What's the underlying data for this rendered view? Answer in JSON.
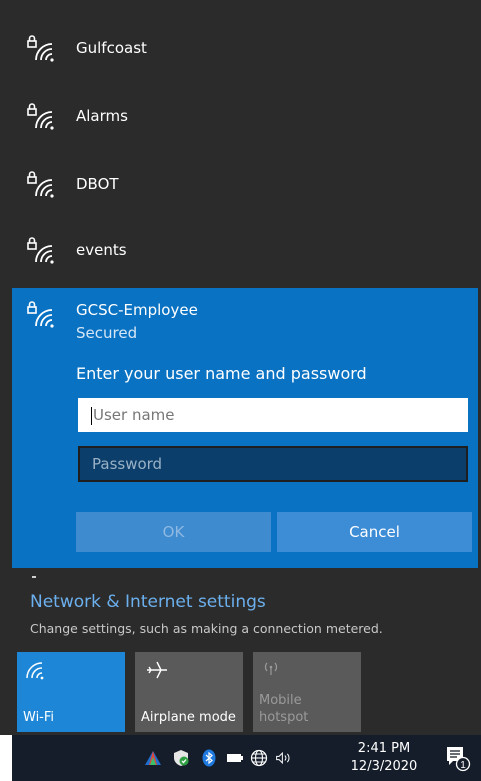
{
  "networks": [
    {
      "name": "Gulfcoast",
      "icon": "secured-wifi-icon"
    },
    {
      "name": "Alarms",
      "icon": "secured-wifi-icon"
    },
    {
      "name": "DBOT",
      "icon": "secured-wifi-icon"
    },
    {
      "name": "events",
      "icon": "secured-wifi-icon"
    }
  ],
  "selected_network": {
    "name": "GCSC-Employee",
    "status": "Secured",
    "prompt": "Enter your user name and password",
    "username_placeholder": "User name",
    "password_placeholder": "Password",
    "ok_label": "OK",
    "cancel_label": "Cancel"
  },
  "settings": {
    "title": "Network & Internet settings",
    "subtitle": "Change settings, such as making a connection metered."
  },
  "quick_actions": [
    {
      "label": "Wi-Fi",
      "icon": "wifi-icon",
      "active": true
    },
    {
      "label": "Airplane mode",
      "icon": "airplane-icon",
      "active": false
    },
    {
      "label": "Mobile hotspot",
      "icon": "hotspot-icon",
      "active": false,
      "disabled": true
    }
  ],
  "taskbar": {
    "time": "2:41 PM",
    "date": "12/3/2020",
    "notification_count": "1",
    "tray_icons": [
      "app-triangle-icon",
      "defender-icon",
      "bluetooth-icon",
      "battery-icon",
      "network-globe-icon",
      "volume-icon"
    ]
  },
  "colors": {
    "flyout_bg": "#2b2b2b",
    "accent": "#0a72c2",
    "link": "#6cb0ee",
    "taskbar_bg": "#151d2b"
  }
}
